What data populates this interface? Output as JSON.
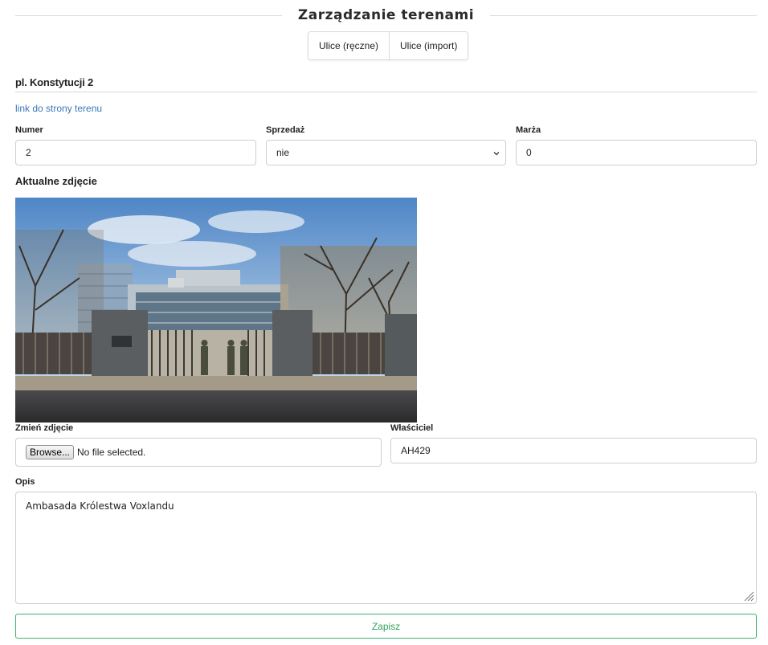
{
  "page": {
    "title": "Zarządzanie terenami",
    "tabs": [
      "Ulice (ręczne)",
      "Ulice (import)"
    ]
  },
  "property": {
    "name": "pl. Konstytucji 2",
    "link_text": "link do strony terenu"
  },
  "fields": {
    "numer": {
      "label": "Numer",
      "value": "2"
    },
    "sprzedaz": {
      "label": "Sprzedaż",
      "value": "nie"
    },
    "marza": {
      "label": "Marża",
      "value": "0"
    }
  },
  "photo": {
    "heading": "Aktualne zdjęcie",
    "change_label": "Zmień zdjęcie",
    "browse_label": "Browse...",
    "file_status": "No file selected."
  },
  "owner": {
    "label": "Właściciel",
    "value": "AH429"
  },
  "description": {
    "label": "Opis",
    "value": "Ambasada Królestwa Voxlandu"
  },
  "save_label": "Zapisz",
  "colors": {
    "link": "#3a78b6",
    "save": "#2fa45a"
  }
}
